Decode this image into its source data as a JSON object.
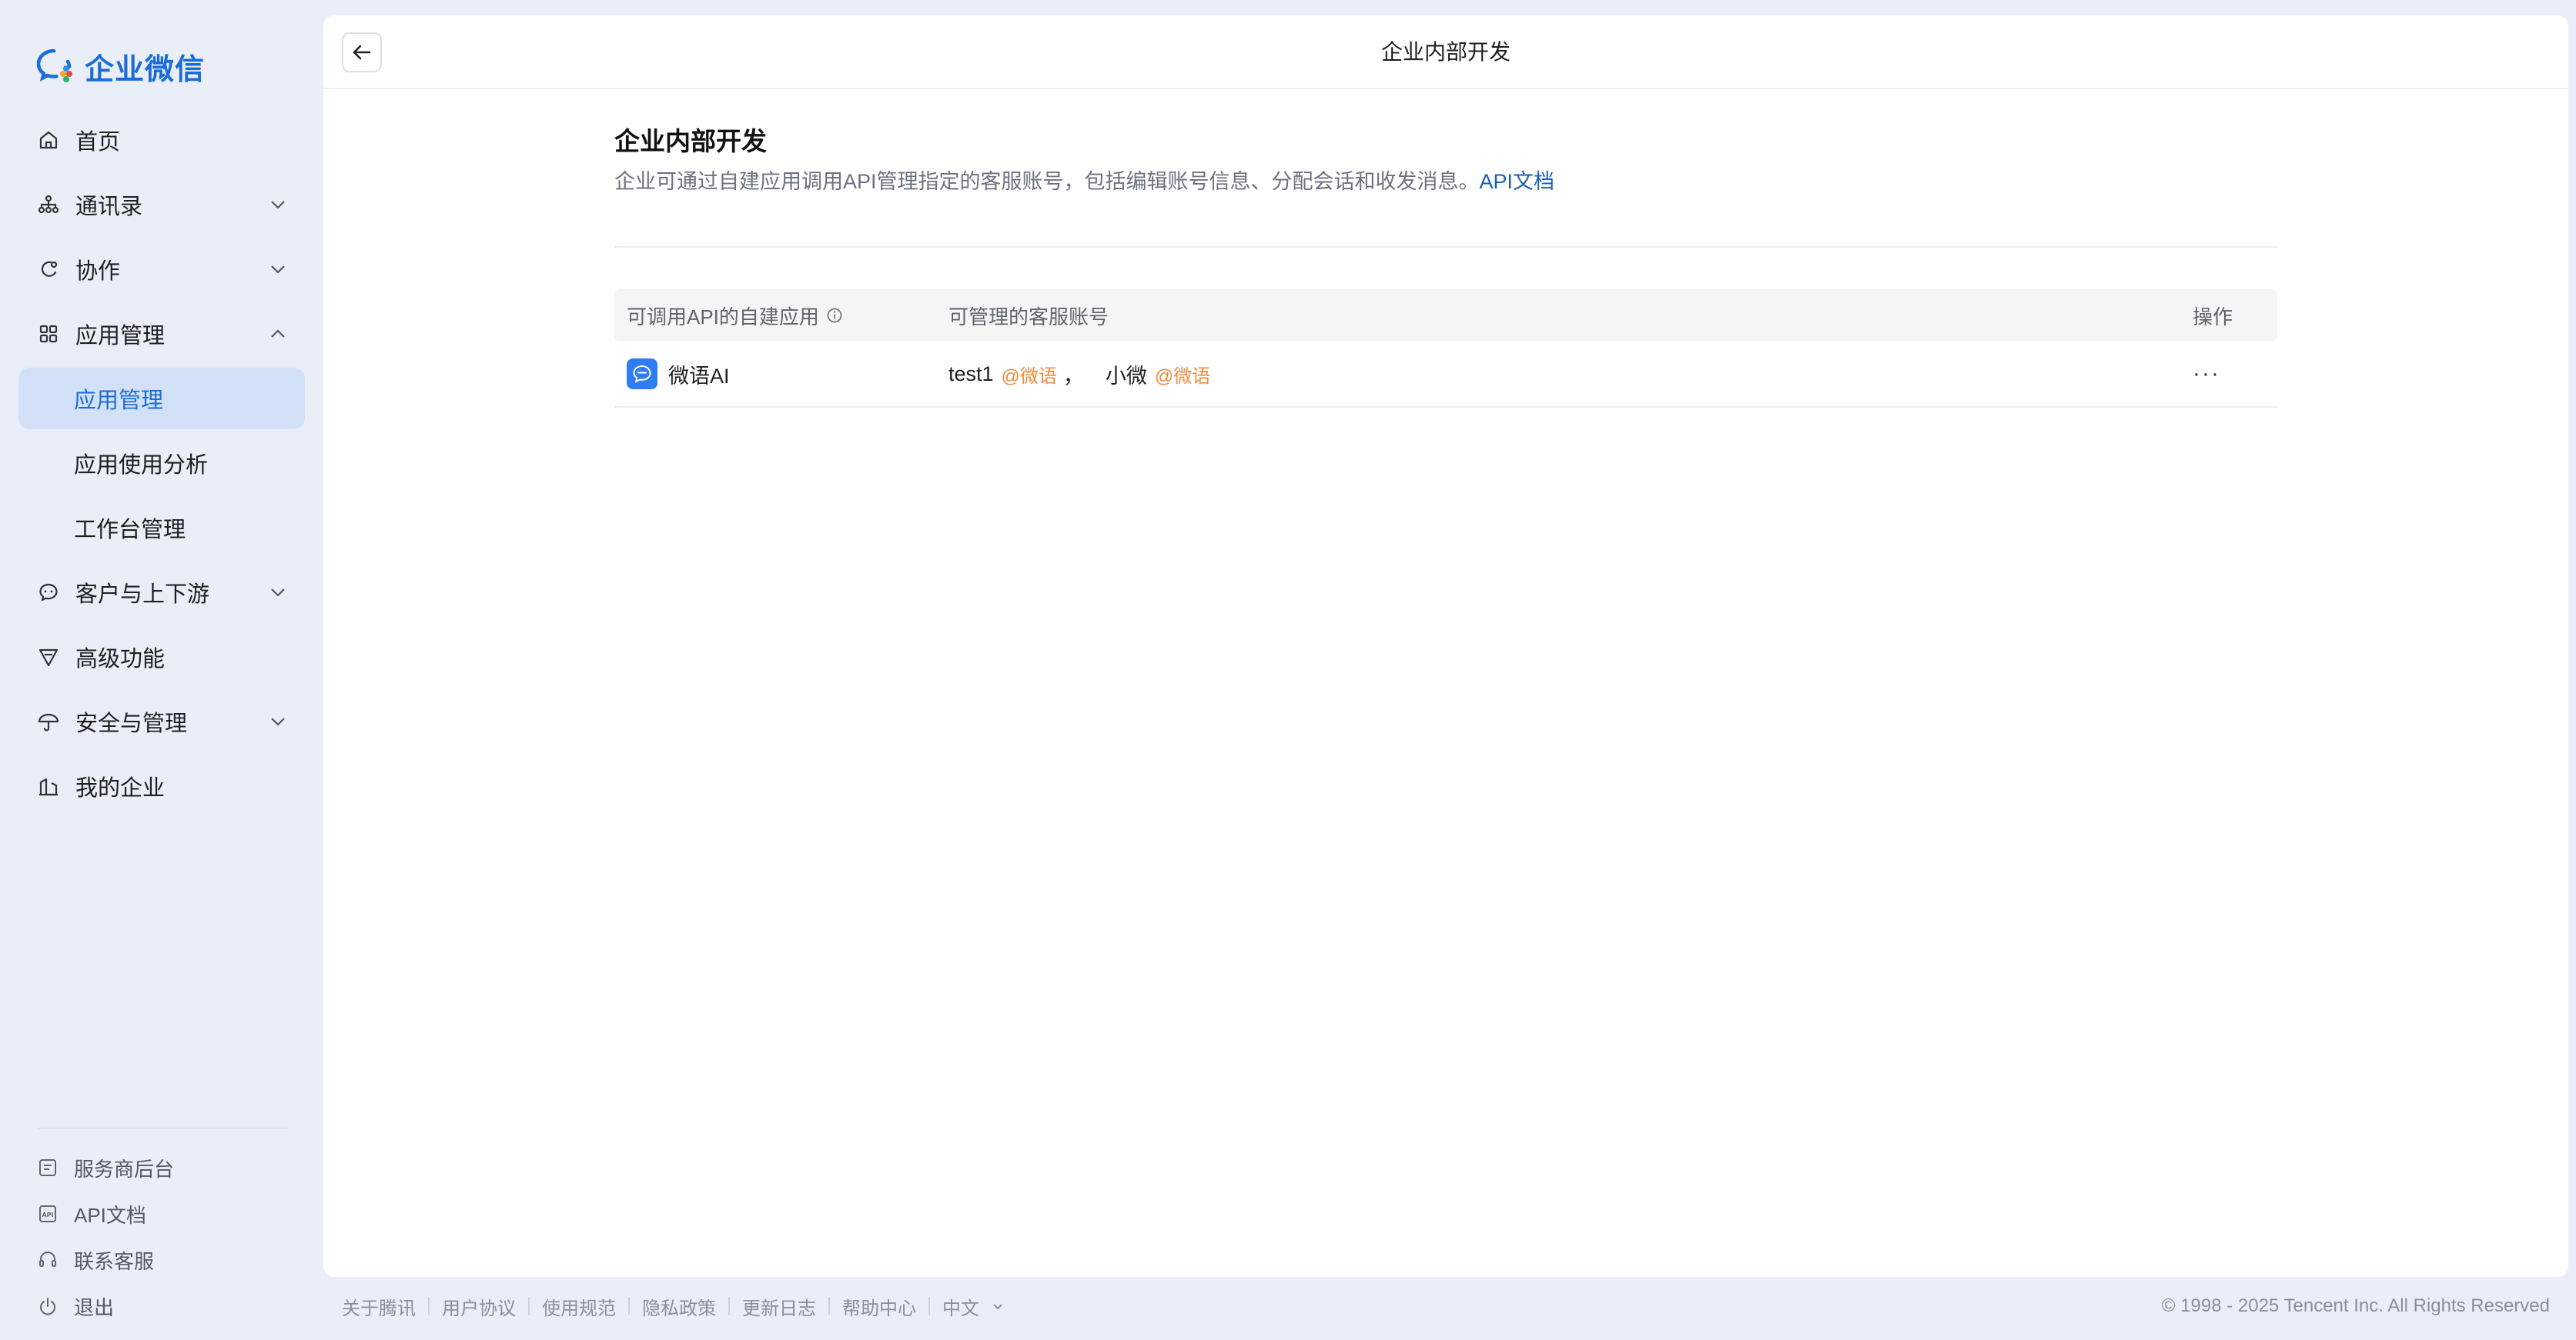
{
  "brand": {
    "name": "企业微信"
  },
  "nav": {
    "home": "首页",
    "contacts": "通讯录",
    "collab": "协作",
    "app_mgmt": "应用管理",
    "app_mgmt_sub": "应用管理",
    "app_analytics": "应用使用分析",
    "workbench": "工作台管理",
    "customers": "客户与上下游",
    "advanced": "高级功能",
    "security": "安全与管理",
    "my_company": "我的企业"
  },
  "footer_nav": {
    "provider": "服务商后台",
    "api_doc": "API文档",
    "support": "联系客服",
    "logout": "退出"
  },
  "header": {
    "title": "企业内部开发"
  },
  "section": {
    "title": "企业内部开发",
    "desc": "企业可通过自建应用调用API管理指定的客服账号，包括编辑账号信息、分配会话和收发消息。",
    "link": "API文档"
  },
  "table": {
    "headers": {
      "app": "可调用API的自建应用",
      "accounts": "可管理的客服账号",
      "actions": "操作"
    },
    "rows": [
      {
        "app_name": "微语AI",
        "accounts": [
          {
            "name": "test1",
            "tag": "@微语",
            "sep": "，"
          },
          {
            "name": "小微",
            "tag": "@微语",
            "sep": ""
          }
        ],
        "more": "···"
      }
    ]
  },
  "page_footer": {
    "links": [
      "关于腾讯",
      "用户协议",
      "使用规范",
      "隐私政策",
      "更新日志",
      "帮助中心"
    ],
    "language": "中文",
    "copyright": "© 1998 - 2025 Tencent Inc. All Rights Reserved"
  },
  "colors": {
    "accent": "#1a6cd9",
    "tag": "#f08a3c",
    "active_bg": "#d3e1f8"
  }
}
